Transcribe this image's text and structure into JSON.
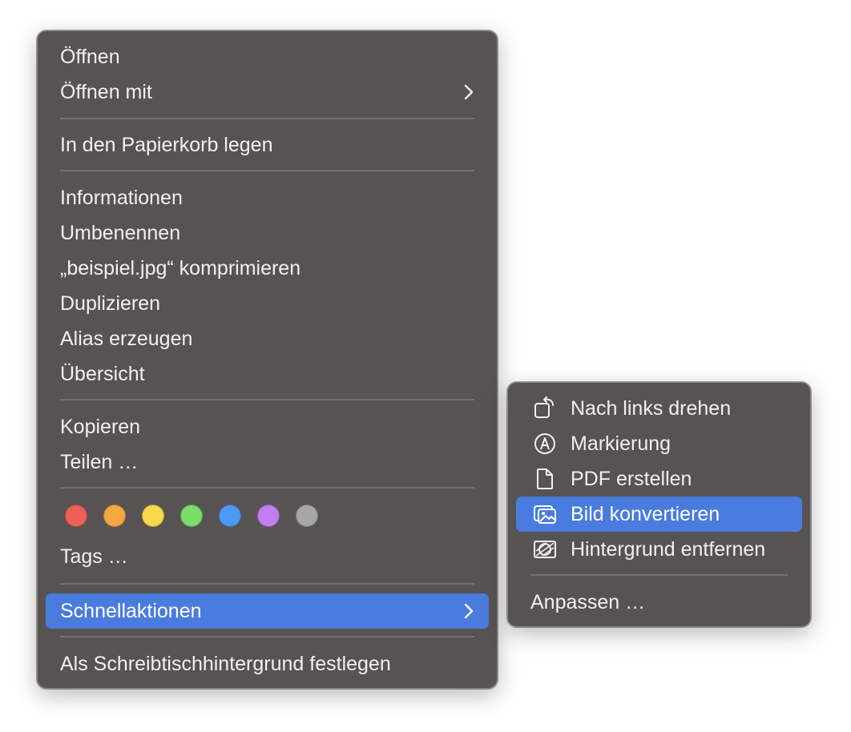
{
  "main_menu": {
    "items": [
      {
        "label": "Öffnen"
      },
      {
        "label": "Öffnen mit"
      },
      {
        "label": "In den Papierkorb legen"
      },
      {
        "label": "Informationen"
      },
      {
        "label": "Umbenennen"
      },
      {
        "label": "„beispiel.jpg“ komprimieren"
      },
      {
        "label": "Duplizieren"
      },
      {
        "label": "Alias erzeugen"
      },
      {
        "label": "Übersicht"
      },
      {
        "label": "Kopieren"
      },
      {
        "label": "Teilen …"
      },
      {
        "label": "Tags …"
      },
      {
        "label": "Schnellaktionen"
      },
      {
        "label": "Als Schreibtischhintergrund festlegen"
      }
    ],
    "tag_colors": [
      "#ee5f59",
      "#f5a742",
      "#f7d94c",
      "#7bdc6a",
      "#4d9af5",
      "#c27ef0",
      "#a7a6a9"
    ],
    "highlight_color": "#4a7bde"
  },
  "sub_menu": {
    "items": [
      {
        "label": "Nach links drehen",
        "icon": "rotate-left-icon"
      },
      {
        "label": "Markierung",
        "icon": "markup-icon"
      },
      {
        "label": "PDF erstellen",
        "icon": "document-icon"
      },
      {
        "label": "Bild konvertieren",
        "icon": "photos-icon"
      },
      {
        "label": "Hintergrund entfernen",
        "icon": "remove-background-icon"
      },
      {
        "label": "Anpassen …"
      }
    ]
  }
}
